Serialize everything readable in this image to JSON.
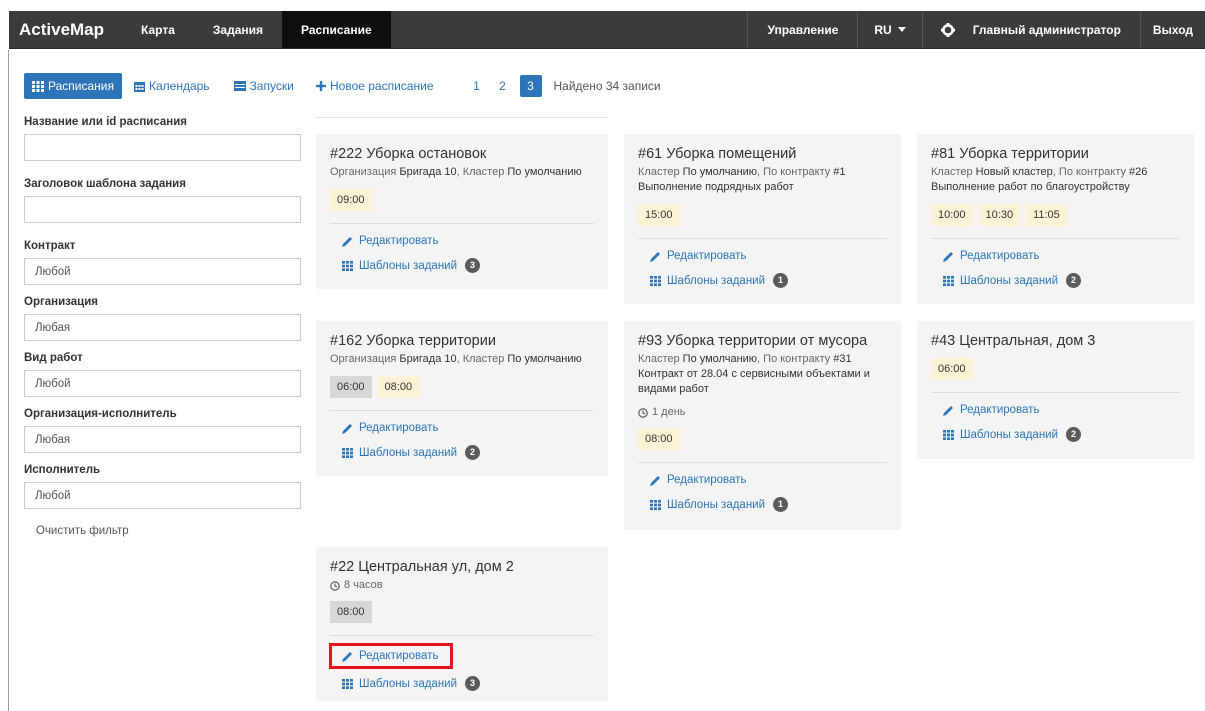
{
  "nav": {
    "brand": "ActiveMap",
    "items": [
      {
        "label": "Карта",
        "active": false
      },
      {
        "label": "Задания",
        "active": false
      },
      {
        "label": "Расписание",
        "active": true
      }
    ],
    "manage": "Управление",
    "lang": "RU",
    "admin": "Главный администратор",
    "logout": "Выход",
    "settings_icon": "gear-icon"
  },
  "tabs": {
    "schedules": "Расписания",
    "calendar": "Календарь",
    "runs": "Запуски"
  },
  "filters": {
    "name_label": "Название или id расписания",
    "name_value": "",
    "template_label": "Заголовок шаблона задания",
    "template_value": "",
    "contract_label": "Контракт",
    "contract_value": "Любой",
    "org_label": "Организация",
    "org_value": "Любая",
    "worktype_label": "Вид работ",
    "worktype_value": "Любой",
    "executor_org_label": "Организация-исполнитель",
    "executor_org_value": "Любая",
    "executor_label": "Исполнитель",
    "executor_value": "Любой",
    "clear": "Очистить фильтр"
  },
  "toolbar": {
    "new_schedule": "Новое расписание",
    "pages": [
      "1",
      "2",
      "3"
    ],
    "active_page": "3",
    "found": "Найдено 34 записи"
  },
  "common": {
    "edit": "Редактировать",
    "templates": "Шаблоны заданий"
  },
  "cards": [
    {
      "title": "#222 Уборка остановок",
      "meta_parts": [
        "Организация ",
        "Бригада 10",
        ", Кластер ",
        "По умолчанию"
      ],
      "times": [
        "09:00"
      ],
      "templates_count": "3"
    },
    {
      "title": "#61 Уборка помещений",
      "meta_parts": [
        "Кластер ",
        "По умолчанию",
        ", По контракту ",
        "#1"
      ],
      "desc": "Выполнение подрядных работ",
      "times": [
        "15:00"
      ],
      "templates_count": "1"
    },
    {
      "title": "#81 Уборка территории",
      "meta_parts": [
        "Кластер ",
        "Новый кластер",
        ", По контракту ",
        "#26"
      ],
      "desc": "Выполнение работ по благоустройству",
      "times": [
        "10:00",
        "10:30",
        "11:05"
      ],
      "templates_count": "2"
    },
    {
      "title": "#162 Уборка территории",
      "meta_parts": [
        "Организация ",
        "Бригада 10",
        ", Кластер ",
        "По умолчанию"
      ],
      "times": [
        "06:00",
        "08:00"
      ],
      "templates_count": "2"
    },
    {
      "title": "#93 Уборка территории от мусора",
      "meta_parts": [
        "Кластер ",
        "По умолчанию",
        ", По контракту ",
        "#31"
      ],
      "desc": "Контракт от 28.04 с сервисными объектами и видами работ",
      "duration": "1 день",
      "times": [
        "08:00"
      ],
      "templates_count": "1"
    },
    {
      "title": "#43 Центральная, дом 3",
      "times": [
        "06:00"
      ],
      "templates_count": "2"
    },
    {
      "title": "#22 Центральная ул, дом 2",
      "duration": "8 часов",
      "times": [
        "08:00"
      ],
      "templates_count": "3"
    }
  ]
}
